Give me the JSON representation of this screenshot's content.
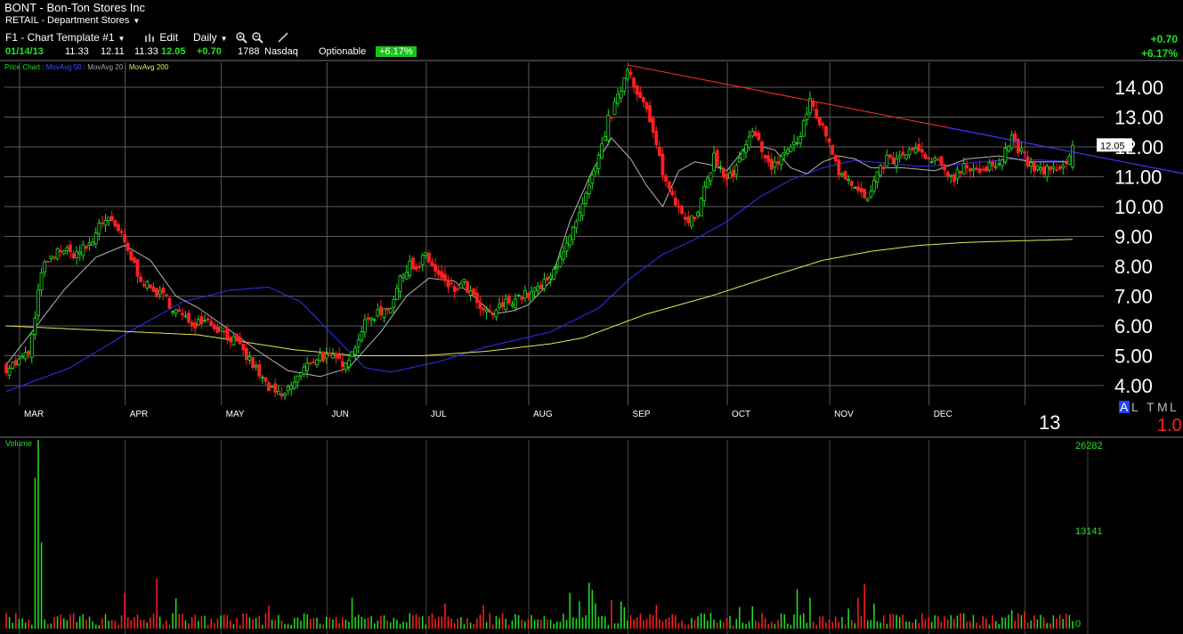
{
  "header": {
    "symbol": "BONT",
    "dash": "-",
    "company": "Bon-Ton Stores Inc",
    "sector": "RETAIL - Department Stores",
    "template": "F1 - Chart Template #1",
    "edit_label": "Edit",
    "period_label": "Daily",
    "quote_date": "01/14/13",
    "open": "11.33",
    "high": "12.11",
    "low": "11.33",
    "last": "12.05",
    "change": "+0.70",
    "volume": "1788",
    "exchange": "Nasdaq",
    "optionable": "Optionable",
    "pct_badge": "+6.17%",
    "change_right": "+0.70",
    "pct_right": "+6.17%"
  },
  "legend": {
    "price_chart": "Price Chart",
    "sep": ":",
    "ma50": "MovAvg 50",
    "ma20": "MovAvg 20",
    "ma200": "MovAvg 200"
  },
  "colors": {
    "up": "#21e221",
    "down": "#ff2020",
    "ma50": "#3030ff",
    "ma20": "#b4b4b4",
    "ma200": "#e6e65a",
    "trend": "#ff3030",
    "grid": "#5a5a5a"
  },
  "icons": [
    "chart-type-icon",
    "zoom-in-icon",
    "zoom-out-icon",
    "draw-tool-icon"
  ],
  "chart_data": {
    "type": "candlestick",
    "title": "BONT - Bon-Ton Stores Inc",
    "yticks": [
      "4.00",
      "5.00",
      "6.00",
      "7.00",
      "8.00",
      "9.00",
      "10.00",
      "11.00",
      "12.00",
      "13.00",
      "14.00"
    ],
    "ylim": [
      3.3,
      15.0
    ],
    "last_price_label": "12.05",
    "month_labels": [
      "MAR",
      "APR",
      "MAY",
      "JUN",
      "JUL",
      "AUG",
      "SEP",
      "OCT",
      "NOV",
      "DEC"
    ],
    "year_label": "13",
    "corner_letters": [
      "A",
      "L",
      "T",
      "M",
      "L"
    ],
    "corner_value": "1.0",
    "volume_panel_label": "Volume",
    "volume_ticks": [
      "26282",
      "13141",
      "0"
    ],
    "volume_max": 26282,
    "grid": true,
    "moving_averages": [
      {
        "name": "MovAvg 50",
        "anchors": [
          [
            0,
            3.8
          ],
          [
            20,
            4.6
          ],
          [
            40,
            5.9
          ],
          [
            55,
            6.8
          ],
          [
            70,
            7.2
          ],
          [
            82,
            7.3
          ],
          [
            92,
            6.8
          ],
          [
            102,
            5.7
          ],
          [
            112,
            4.6
          ],
          [
            120,
            4.45
          ],
          [
            135,
            4.8
          ],
          [
            150,
            5.3
          ],
          [
            170,
            5.8
          ],
          [
            185,
            6.6
          ],
          [
            195,
            7.6
          ],
          [
            205,
            8.4
          ],
          [
            215,
            8.9
          ],
          [
            225,
            9.5
          ],
          [
            235,
            10.3
          ],
          [
            245,
            10.9
          ],
          [
            255,
            11.3
          ],
          [
            265,
            11.55
          ],
          [
            275,
            11.45
          ],
          [
            285,
            11.35
          ],
          [
            295,
            11.4
          ],
          [
            305,
            11.5
          ],
          [
            315,
            11.6
          ],
          [
            325,
            11.55
          ],
          [
            333,
            11.5
          ]
        ]
      },
      {
        "name": "MovAvg 20",
        "anchors": [
          [
            0,
            4.7
          ],
          [
            8,
            5.8
          ],
          [
            18,
            7.2
          ],
          [
            28,
            8.3
          ],
          [
            37,
            8.7
          ],
          [
            45,
            8.2
          ],
          [
            53,
            7.0
          ],
          [
            60,
            6.6
          ],
          [
            68,
            6.0
          ],
          [
            78,
            5.2
          ],
          [
            88,
            4.5
          ],
          [
            98,
            4.3
          ],
          [
            107,
            4.6
          ],
          [
            117,
            5.8
          ],
          [
            125,
            7.0
          ],
          [
            132,
            7.6
          ],
          [
            140,
            7.5
          ],
          [
            147,
            6.9
          ],
          [
            152,
            6.4
          ],
          [
            158,
            6.5
          ],
          [
            163,
            6.7
          ],
          [
            170,
            7.5
          ],
          [
            176,
            9.5
          ],
          [
            183,
            11.2
          ],
          [
            189,
            12.3
          ],
          [
            195,
            11.6
          ],
          [
            200,
            10.7
          ],
          [
            205,
            10.0
          ],
          [
            210,
            11.2
          ],
          [
            215,
            11.5
          ],
          [
            220,
            11.4
          ],
          [
            225,
            11.2
          ],
          [
            231,
            12.0
          ],
          [
            236,
            12.0
          ],
          [
            240,
            11.9
          ],
          [
            245,
            11.3
          ],
          [
            250,
            11.1
          ],
          [
            255,
            11.5
          ],
          [
            260,
            11.7
          ],
          [
            265,
            11.6
          ],
          [
            270,
            11.3
          ],
          [
            280,
            11.3
          ],
          [
            290,
            11.2
          ],
          [
            300,
            11.6
          ],
          [
            310,
            11.7
          ],
          [
            320,
            11.5
          ],
          [
            333,
            11.5
          ]
        ]
      },
      {
        "name": "MovAvg 200",
        "anchors": [
          [
            0,
            6.0
          ],
          [
            30,
            5.85
          ],
          [
            60,
            5.7
          ],
          [
            90,
            5.2
          ],
          [
            110,
            5.0
          ],
          [
            130,
            5.0
          ],
          [
            150,
            5.15
          ],
          [
            170,
            5.4
          ],
          [
            180,
            5.6
          ],
          [
            190,
            6.0
          ],
          [
            200,
            6.4
          ],
          [
            220,
            7.0
          ],
          [
            240,
            7.7
          ],
          [
            255,
            8.2
          ],
          [
            270,
            8.5
          ],
          [
            285,
            8.7
          ],
          [
            300,
            8.8
          ],
          [
            315,
            8.85
          ],
          [
            333,
            8.9
          ]
        ]
      }
    ],
    "trendline": {
      "start": [
        194,
        14.75
      ],
      "mid": [
        233,
        13.8
      ],
      "end": [
        294,
        12.65
      ],
      "start_bar": 194,
      "end_bar": 333
    },
    "price_anchors": [
      [
        0,
        4.6
      ],
      [
        4,
        4.8
      ],
      [
        7,
        5.1
      ],
      [
        9,
        6.2
      ],
      [
        11,
        7.9
      ],
      [
        14,
        8.2
      ],
      [
        17,
        8.6
      ],
      [
        20,
        8.4
      ],
      [
        23,
        8.5
      ],
      [
        27,
        8.8
      ],
      [
        29,
        9.5
      ],
      [
        32,
        9.5
      ],
      [
        35,
        9.2
      ],
      [
        38,
        8.5
      ],
      [
        41,
        7.8
      ],
      [
        44,
        7.3
      ],
      [
        47,
        7.1
      ],
      [
        50,
        6.9
      ],
      [
        53,
        6.5
      ],
      [
        56,
        6.2
      ],
      [
        59,
        6.1
      ],
      [
        62,
        6.3
      ],
      [
        65,
        6.0
      ],
      [
        68,
        5.8
      ],
      [
        71,
        5.5
      ],
      [
        74,
        5.1
      ],
      [
        77,
        4.7
      ],
      [
        80,
        4.2
      ],
      [
        83,
        3.8
      ],
      [
        86,
        3.6
      ],
      [
        89,
        4.0
      ],
      [
        92,
        4.4
      ],
      [
        95,
        4.8
      ],
      [
        98,
        5.0
      ],
      [
        101,
        4.9
      ],
      [
        105,
        4.8
      ],
      [
        108,
        5.1
      ],
      [
        111,
        5.9
      ],
      [
        114,
        6.3
      ],
      [
        117,
        6.5
      ],
      [
        120,
        6.7
      ],
      [
        123,
        7.5
      ],
      [
        126,
        8.2
      ],
      [
        128,
        7.8
      ],
      [
        131,
        8.4
      ],
      [
        134,
        7.8
      ],
      [
        137,
        7.4
      ],
      [
        140,
        7.2
      ],
      [
        143,
        7.4
      ],
      [
        146,
        6.9
      ],
      [
        149,
        6.4
      ],
      [
        152,
        6.4
      ],
      [
        155,
        6.7
      ],
      [
        158,
        6.9
      ],
      [
        161,
        7.0
      ],
      [
        164,
        7.1
      ],
      [
        167,
        7.3
      ],
      [
        170,
        7.6
      ],
      [
        173,
        8.4
      ],
      [
        176,
        8.9
      ],
      [
        179,
        9.7
      ],
      [
        182,
        10.6
      ],
      [
        185,
        11.6
      ],
      [
        188,
        12.9
      ],
      [
        191,
        13.6
      ],
      [
        194,
        14.7
      ],
      [
        197,
        13.9
      ],
      [
        200,
        13.2
      ],
      [
        203,
        12.0
      ],
      [
        206,
        10.8
      ],
      [
        209,
        10.2
      ],
      [
        212,
        9.7
      ],
      [
        215,
        9.5
      ],
      [
        218,
        10.5
      ],
      [
        221,
        11.7
      ],
      [
        224,
        11.0
      ],
      [
        227,
        11.0
      ],
      [
        230,
        11.8
      ],
      [
        233,
        12.4
      ],
      [
        236,
        12.0
      ],
      [
        239,
        11.2
      ],
      [
        242,
        11.7
      ],
      [
        245,
        12.0
      ],
      [
        248,
        12.3
      ],
      [
        251,
        13.6
      ],
      [
        254,
        12.8
      ],
      [
        257,
        12.2
      ],
      [
        260,
        11.2
      ],
      [
        263,
        11.0
      ],
      [
        266,
        10.5
      ],
      [
        269,
        10.2
      ],
      [
        272,
        11.0
      ],
      [
        275,
        11.6
      ],
      [
        278,
        11.5
      ],
      [
        281,
        11.8
      ],
      [
        284,
        11.9
      ],
      [
        287,
        11.6
      ],
      [
        290,
        11.5
      ],
      [
        293,
        11.2
      ],
      [
        296,
        11.0
      ],
      [
        299,
        11.4
      ],
      [
        302,
        11.3
      ],
      [
        305,
        11.1
      ],
      [
        308,
        11.4
      ],
      [
        311,
        11.7
      ],
      [
        314,
        12.3
      ],
      [
        317,
        11.8
      ],
      [
        320,
        11.3
      ],
      [
        323,
        11.2
      ],
      [
        326,
        11.3
      ],
      [
        329,
        11.1
      ],
      [
        333,
        12.05
      ]
    ],
    "volume_spikes": [
      [
        9,
        21000
      ],
      [
        10,
        26282
      ],
      [
        11,
        12000
      ],
      [
        37,
        5000
      ],
      [
        47,
        7000
      ],
      [
        53,
        4200
      ],
      [
        82,
        3200
      ],
      [
        108,
        4300
      ],
      [
        137,
        3500
      ],
      [
        149,
        3300
      ],
      [
        176,
        5000
      ],
      [
        179,
        3800
      ],
      [
        182,
        6400
      ],
      [
        183,
        5400
      ],
      [
        184,
        3500
      ],
      [
        189,
        4000
      ],
      [
        192,
        3800
      ],
      [
        193,
        3000
      ],
      [
        203,
        3300
      ],
      [
        229,
        3000
      ],
      [
        233,
        3100
      ],
      [
        247,
        5500
      ],
      [
        251,
        4300
      ],
      [
        263,
        2800
      ],
      [
        266,
        4300
      ],
      [
        268,
        6200
      ],
      [
        271,
        3500
      ],
      [
        314,
        2600
      ],
      [
        318,
        2400
      ]
    ]
  }
}
